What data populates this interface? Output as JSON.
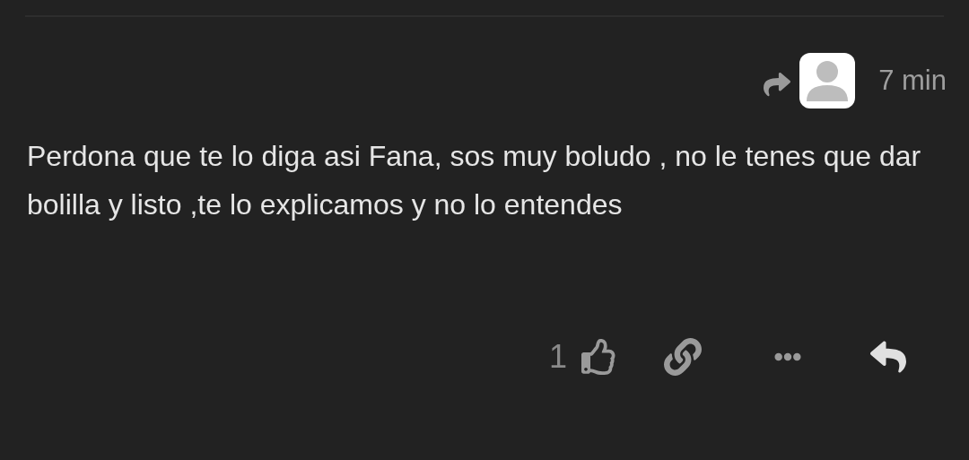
{
  "comment": {
    "time": "7 min",
    "text": "Perdona que te lo diga asi Fana, sos muy boludo , no le tenes que dar bolilla y listo ,te lo explicamos y no lo entendes",
    "likes": "1"
  }
}
